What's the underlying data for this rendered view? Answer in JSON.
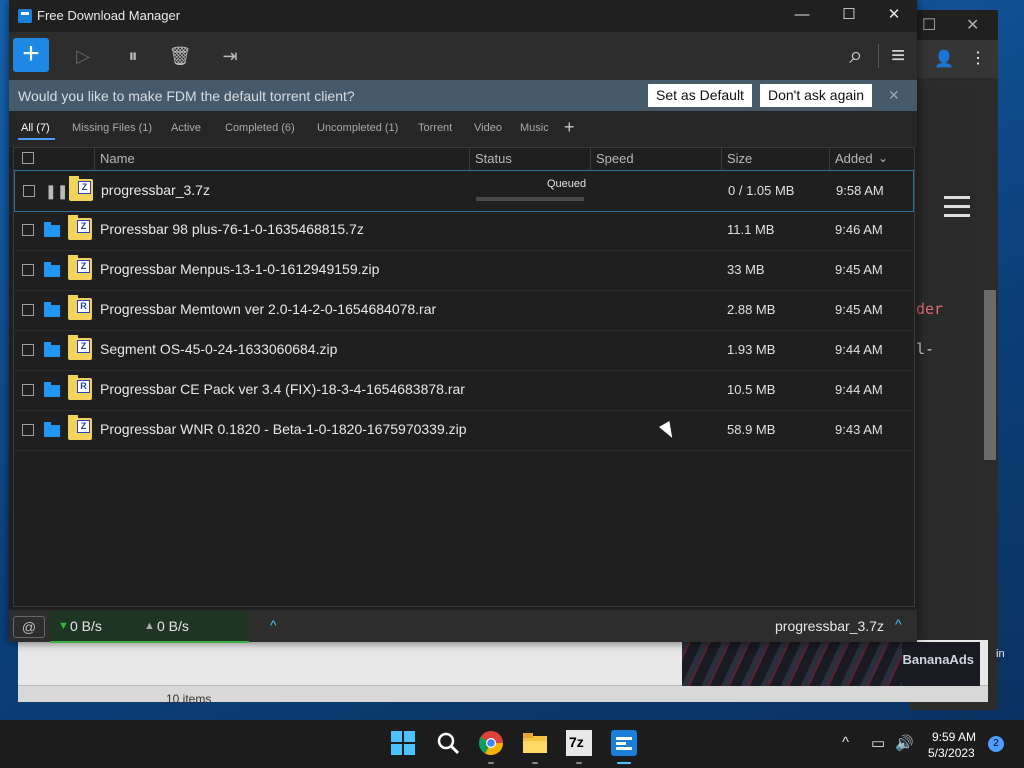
{
  "window": {
    "title": "Free Download Manager",
    "minimize": "—",
    "maximize": "☐",
    "close": "✕"
  },
  "toolbar": {
    "add": "+",
    "start": "▷",
    "pause": "⏸",
    "delete": "🗑",
    "move": "⇥",
    "search": "⌕",
    "menu": "≡"
  },
  "notice": {
    "text": "Would you like to make FDM the default torrent client?",
    "set_default": "Set as Default",
    "dont_ask": "Don't ask again",
    "close": "✕"
  },
  "filters": [
    {
      "label": "All (7)",
      "active": true
    },
    {
      "label": "Missing Files (1)"
    },
    {
      "label": "Active"
    },
    {
      "label": "Completed (6)"
    },
    {
      "label": "Uncompleted (1)"
    },
    {
      "label": "Torrent"
    },
    {
      "label": "Video"
    },
    {
      "label": "Music"
    }
  ],
  "filter_add": "+",
  "columns": {
    "name": "Name",
    "status": "Status",
    "speed": "Speed",
    "size": "Size",
    "added": "Added",
    "sort_icon": "⌄"
  },
  "rows": [
    {
      "name": "progressbar_3.7z",
      "type": "Z",
      "status": "Queued",
      "size": "0 / 1.05 MB",
      "added": "9:58 AM",
      "progress": 0,
      "state_icon": "pause-icon"
    },
    {
      "name": "Proressbar 98 plus-76-1-0-1635468815.7z",
      "type": "Z",
      "size": "11.1 MB",
      "added": "9:46 AM"
    },
    {
      "name": "Progressbar Menpus-13-1-0-1612949159.zip",
      "type": "Z",
      "size": "33 MB",
      "added": "9:45 AM"
    },
    {
      "name": "Progressbar Memtown ver 2.0-14-2-0-1654684078.rar",
      "type": "R",
      "size": "2.88 MB",
      "added": "9:45 AM"
    },
    {
      "name": "Segment OS-45-0-24-1633060684.zip",
      "type": "Z",
      "size": "1.93 MB",
      "added": "9:44 AM"
    },
    {
      "name": "Progressbar CE Pack ver 3.4 (FIX)-18-3-4-1654683878.rar",
      "type": "R",
      "size": "10.5 MB",
      "added": "9:44 AM"
    },
    {
      "name": "Progressbar WNR 0.1820 - Beta-1-0-1820-1675970339.zip",
      "type": "Z",
      "size": "58.9 MB",
      "added": "9:43 AM"
    }
  ],
  "statusbar": {
    "down_arrow": "▼",
    "down_speed": "0 B/s",
    "up_arrow": "▲",
    "up_speed": "0 B/s",
    "speed_toggle": "^",
    "current_file": "progressbar_3.7z",
    "current_toggle": "^"
  },
  "background": {
    "code_line_1": "der",
    "code_line_2": "l-",
    "explorer_items": "10 items",
    "ad_label": "BananaAds",
    "right_text": "in"
  },
  "taskbar": {
    "time": "9:59 AM",
    "date": "5/3/2023",
    "notifications": "2",
    "tray_chevron": "^",
    "sevenzip_label": "7z"
  },
  "colors": {
    "accent": "#1e88e5",
    "notice_bar": "#465a6a",
    "speed_indicator": "#3cb043"
  }
}
